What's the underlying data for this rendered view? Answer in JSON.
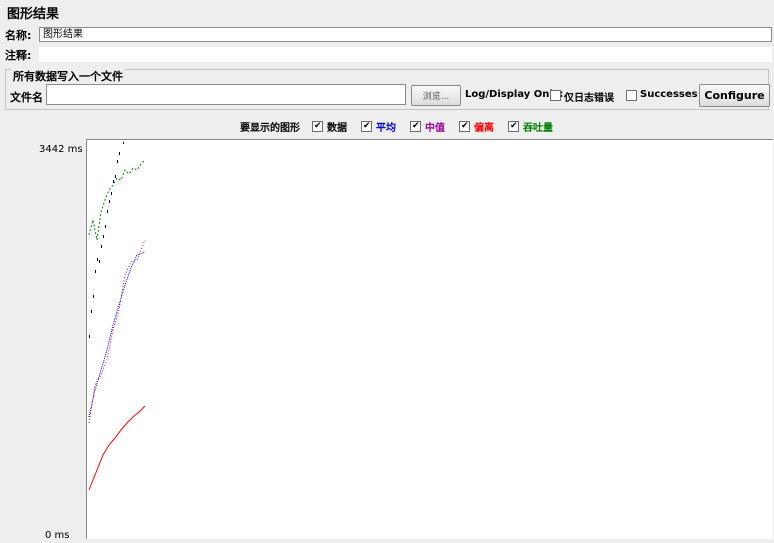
{
  "panel_title": "图形结果",
  "name_label": "名称:",
  "name_value": "图形结果",
  "comment_label": "注释:",
  "comment_value": "",
  "file_group_legend": "所有数据写入一个文件",
  "file_label": "文件名",
  "file_value": "",
  "browse_label": "浏览...",
  "log_display_label": "Log/Display Only:",
  "errors_only_label": "仅日志错误",
  "errors_only_checked": false,
  "successes_label": "Successes",
  "successes_checked": false,
  "configure_label": "Configure",
  "display_label": "要显示的图形",
  "series": [
    {
      "label": "数据",
      "color": "#000000",
      "checked": true
    },
    {
      "label": "平均",
      "color": "#0000cc",
      "checked": true
    },
    {
      "label": "中值",
      "color": "#990099",
      "checked": true
    },
    {
      "label": "偏离",
      "color": "#ff0000",
      "checked": true
    },
    {
      "label": "吞吐量",
      "color": "#008000",
      "checked": true
    }
  ],
  "y_max_label": "3442  ms",
  "y_min_label": "0 ms"
}
